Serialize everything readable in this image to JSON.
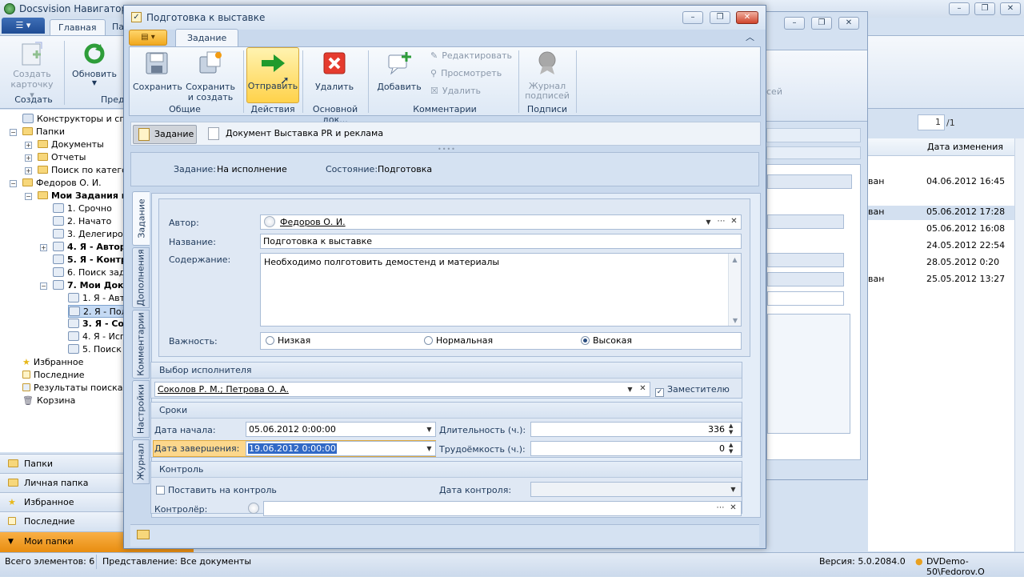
{
  "app": {
    "title": "Docsvision Навигатор",
    "menu_label": "☰ ▾",
    "tabs": [
      "Главная",
      "Па"
    ],
    "ribbon": {
      "create_label": "Создать карточку ▾",
      "refresh_label": "Обновить",
      "group_create": "Создать",
      "group_pred": "Пред"
    }
  },
  "tree": {
    "items": [
      {
        "label": "Конструкторы и справ"
      },
      {
        "label": "Папки"
      },
      {
        "label": "Документы"
      },
      {
        "label": "Отчеты"
      },
      {
        "label": "Поиск по катего"
      },
      {
        "label": "Федоров О. И."
      },
      {
        "label": "Мои Задания и Д"
      },
      {
        "label": "1. Срочно"
      },
      {
        "label": "2. Начато"
      },
      {
        "label": "3. Делегиров"
      },
      {
        "label": "4. Я - Автор"
      },
      {
        "label": "5. Я - Контрол"
      },
      {
        "label": "6. Поиск зада"
      },
      {
        "label": "7. Мои Докум"
      },
      {
        "label": "1. Я - Авто"
      },
      {
        "label": "2. Я - Полу"
      },
      {
        "label": "3. Я - Согл"
      },
      {
        "label": "4. Я - Испо"
      },
      {
        "label": "5. Поиск д"
      },
      {
        "label": "Избранное"
      },
      {
        "label": "Последние"
      },
      {
        "label": "Результаты поиска"
      },
      {
        "label": "Корзина"
      }
    ]
  },
  "navpane": {
    "items": [
      "Папки",
      "Личная папка",
      "Избранное",
      "Последние",
      "Мои папки"
    ]
  },
  "list": {
    "pager_value": "1",
    "pager_total": "/1",
    "col_header": "Дата изменения",
    "rows": [
      {
        "prefix": "ван",
        "date": "04.06.2012 16:45"
      },
      {
        "prefix": "ван",
        "date": "05.06.2012 17:28"
      },
      {
        "prefix": "",
        "date": "05.06.2012 16:08"
      },
      {
        "prefix": "",
        "date": "24.05.2012 22:54"
      },
      {
        "prefix": "",
        "date": "28.05.2012 0:20"
      },
      {
        "prefix": "ван",
        "date": "25.05.2012 13:27"
      }
    ]
  },
  "midwin": {
    "sig_text": "сей"
  },
  "status": {
    "count": "Всего элементов: 6",
    "view": "Представление: Все документы",
    "version": "Версия: 5.0.2084.0",
    "user": "DVDemo-50\\Fedorov.O"
  },
  "dialog": {
    "title": "Подготовка к выставке",
    "menu_glyph": "▤ ▾",
    "tab": "Задание",
    "collapse_glyph": "︿",
    "ribbon": {
      "save": "Сохранить",
      "save_create": "Сохранить и создать",
      "send": "Отправить",
      "delete": "Удалить",
      "add": "Добавить",
      "edit": "Редактировать",
      "view": "Просмотреть",
      "delete_comment": "Удалить",
      "journal": "Журнал подписей",
      "groups": {
        "general": "Общие",
        "actions": "Действия",
        "main_doc": "Основной док...",
        "comments": "Комментарии",
        "signatures": "Подписи"
      }
    },
    "doc_tabs": {
      "task": "Задание",
      "document": "Документ Выставка PR и реклама"
    },
    "info": {
      "task_label": "Задание:",
      "task_value": "На исполнение",
      "state_label": "Состояние:",
      "state_value": "Подготовка"
    },
    "side_tabs": [
      "Задание",
      "Дополнения",
      "Комментарии",
      "Настройки",
      "Журнал"
    ],
    "form": {
      "author_label": "Автор:",
      "author_value": "Федоров О. И.",
      "name_label": "Название:",
      "name_value": "Подготовка к выставке",
      "content_label": "Содержание:",
      "content_value": "Необходимо полготовить демостенд и материалы",
      "importance_label": "Важность:",
      "importance_options": [
        "Низкая",
        "Нормальная",
        "Высокая"
      ],
      "importance_selected": "Высокая"
    },
    "executor": {
      "header": "Выбор исполнителя",
      "value": "Соколов Р. М.; Петрова О. А.",
      "deputy_label": "Заместителю",
      "deputy_checked": true
    },
    "terms": {
      "header": "Сроки",
      "start_label": "Дата начала:",
      "start_value": "05.06.2012 0:00:00",
      "end_label": "Дата завершения:",
      "end_value": "19.06.2012 0:00:00",
      "duration_label": "Длительность (ч.):",
      "duration_value": "336",
      "labor_label": "Трудоёмкость (ч.):",
      "labor_value": "0"
    },
    "control": {
      "header": "Контроль",
      "put_label": "Поставить на контроль",
      "date_label": "Дата контроля:",
      "controller_label": "Контролёр:"
    }
  }
}
